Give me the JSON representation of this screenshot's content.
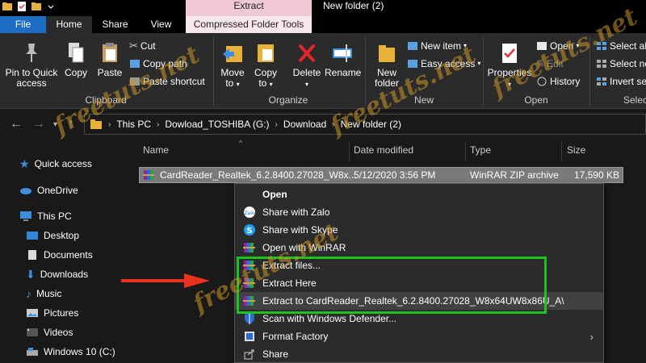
{
  "titlebar": {
    "context_tab_header": "Extract",
    "window_title": "New folder (2)"
  },
  "tabs": {
    "file": "File",
    "home": "Home",
    "share": "Share",
    "view": "View",
    "compressed": "Compressed Folder Tools"
  },
  "ribbon": {
    "pin": "Pin to Quick access",
    "copy": "Copy",
    "paste": "Paste",
    "cut": "Cut",
    "copy_path": "Copy path",
    "paste_shortcut": "Paste shortcut",
    "clipboard": "Clipboard",
    "move_to": "Move to",
    "copy_to": "Copy to",
    "delete": "Delete",
    "rename": "Rename",
    "organize": "Organize",
    "new_folder": "New folder",
    "new_item": "New item",
    "easy_access": "Easy access",
    "new": "New",
    "properties": "Properties",
    "open": "Open",
    "edit": "Edit",
    "history": "History",
    "open_group": "Open",
    "select_all": "Select al",
    "select_none": "Select no",
    "invert_selection": "Invert se",
    "select_group": "Selec"
  },
  "address": {
    "crumbs": [
      "This PC",
      "Dowload_TOSHIBA (G:)",
      "Download",
      "New folder (2)"
    ]
  },
  "navpane": {
    "items": [
      "Quick access",
      "OneDrive",
      "This PC",
      "Desktop",
      "Documents",
      "Downloads",
      "Music",
      "Pictures",
      "Videos",
      "Windows 10 (C:)"
    ]
  },
  "columns": {
    "name": "Name",
    "date": "Date modified",
    "type": "Type",
    "size": "Size"
  },
  "file": {
    "name": "CardReader_Realtek_6.2.8400.27028_W8x...",
    "date": "5/12/2020 3:56 PM",
    "type": "WinRAR ZIP archive",
    "size": "17,590 KB"
  },
  "menu": {
    "items": [
      "Open",
      "Share with Zalo",
      "Share with Skype",
      "Open with WinRAR",
      "Extract files...",
      "Extract Here",
      "Extract to CardReader_Realtek_6.2.8400.27028_W8x64UW8x86U_A\\",
      "Scan with Windows Defender...",
      "Format Factory",
      "Share"
    ],
    "submenu_glyph": "›"
  },
  "watermark": {
    "text": "freetuts.net"
  },
  "colors": {
    "accent": "#1b6ec4",
    "highlight_box": "#1ec21e",
    "arrow": "#e8321e",
    "context_tab": "#f7e6ed"
  }
}
